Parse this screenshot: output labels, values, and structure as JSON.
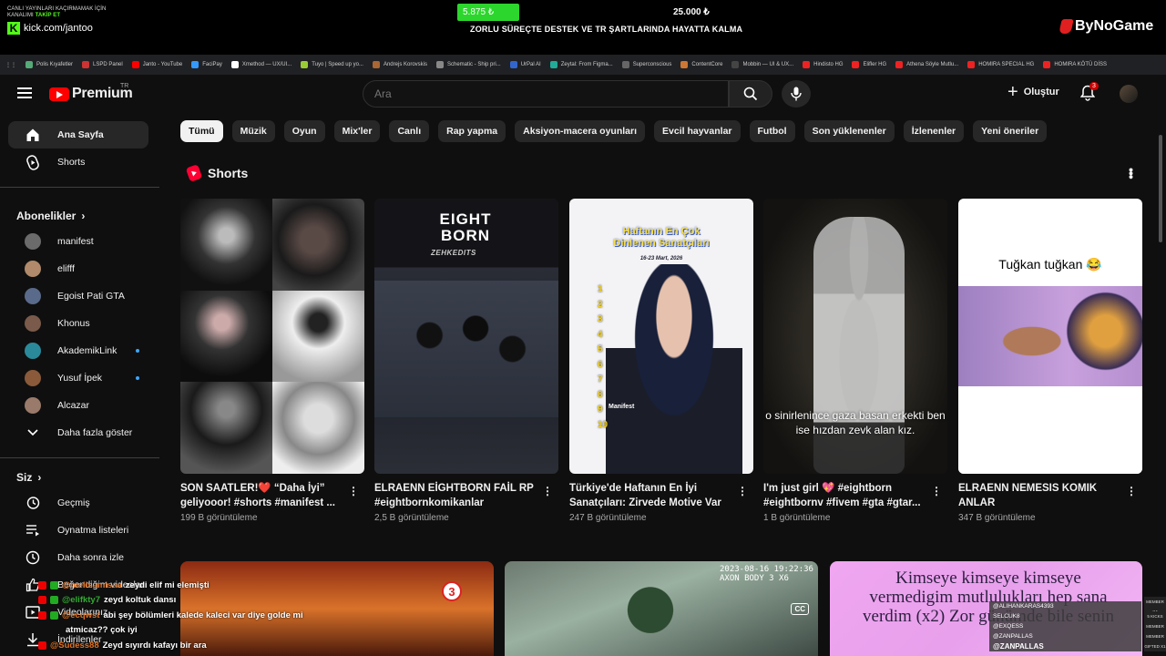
{
  "overlay": {
    "promo_line1": "CANLI YAYINLARI KAÇIRMAMAK İÇİN",
    "promo_line2_a": "KANALIMI ",
    "promo_line2_b": "TAKİP ET",
    "kick_url": "kick.com/jantoo",
    "goal_current": "5.875 ₺",
    "goal_target": "25.000 ₺",
    "goal_caption": "ZORLU SÜREÇTE DESTEK VE TR ŞARTLARINDA HAYATTA KALMA",
    "goal_progress": 0.235,
    "brand": "ByNoGame"
  },
  "bookmarks": [
    "Polis Kıyafetler",
    "LSPD Panel",
    "Janto - YouTube",
    "FaciPay",
    "Xmethod — UX/UI...",
    "Tuyo | Speed up yo...",
    "Andrejs Korovskis",
    "Schematic - Ship pri...",
    "UrPal AI",
    "Zeytal: From Figma...",
    "Superconscious",
    "ContentCore",
    "Mobbin — UI & UX...",
    "Hindisto HG",
    "Elifler HG",
    "Athena Söyle Mutlu...",
    "HOMIRA SPECIAL HG",
    "HOMIRA KÖTÜ DİSS"
  ],
  "masthead": {
    "logo_text": "Premium",
    "country": "TR",
    "search_placeholder": "Ara",
    "create_label": "Oluştur",
    "notifications_count": "3"
  },
  "sidebar": {
    "home": "Ana Sayfa",
    "shorts": "Shorts",
    "subscriptions_title": "Abonelikler",
    "subscriptions": [
      {
        "name": "manifest",
        "color": "#6b6b6b",
        "live": false
      },
      {
        "name": "elifff",
        "color": "#b08a6a",
        "live": false
      },
      {
        "name": "Egoist Pati GTA",
        "color": "#5a6a8a",
        "live": false
      },
      {
        "name": "Khonus",
        "color": "#7a5a4a",
        "live": false
      },
      {
        "name": "AkademikLink",
        "color": "#2a8a9a",
        "live": true
      },
      {
        "name": "Yusuf İpek",
        "color": "#8a5a3a",
        "live": true
      },
      {
        "name": "Alcazar",
        "color": "#9a7a6a",
        "live": false
      }
    ],
    "show_more": "Daha fazla göster",
    "you_title": "Siz",
    "you_items": [
      "Geçmiş",
      "Oynatma listeleri",
      "Daha sonra izle",
      "Beğendiğim videolar",
      "Videolarınız",
      "İndirilenler"
    ]
  },
  "chips": [
    "Tümü",
    "Müzik",
    "Oyun",
    "Mix'ler",
    "Canlı",
    "Rap yapma",
    "Aksiyon-macera oyunları",
    "Evcil hayvanlar",
    "Futbol",
    "Son yüklenenler",
    "İzlenenler",
    "Yeni öneriler"
  ],
  "shorts": {
    "title": "Shorts",
    "items": [
      {
        "title": "SON SAATLER!❤️ “Daha İyi” geliyooor! #shorts #manifest ...",
        "views": "199 B görüntüleme"
      },
      {
        "title": "ELRAENN EİGHTBORN FAİL RP #eightbornkomikanlar",
        "views": "2,5 B görüntüleme"
      },
      {
        "title": "Türkiye'de Haftanın En İyi Sanatçıları: Zirvede Motive Var",
        "views": "247 B görüntüleme"
      },
      {
        "title": "I'm just girl 💖 #eightborn #eightbornv #fivem #gta #gtar...",
        "views": "1 B görüntüleme"
      },
      {
        "title": "ELRAENN NEMESIS KOMIK ANLAR",
        "views": "347 B görüntüleme"
      }
    ],
    "t2_logo": "EIGHT BORN",
    "t2_tag": "ZEHKEDITS",
    "t3_title_a": "Haftanın En Çok",
    "t3_title_b": "Dinlenen Sanatçıları",
    "t3_date": "16-23 Mart, 2026",
    "t3_numbers": "1 2 3 4 5 6 7 8 9 10",
    "t3_manifest": "Manifest",
    "t4_caption": "o sinirlenince gaza basan erkekti ben ise hızdan zevk alan kız.",
    "t5_caption": "Tuğkan tuğkan 😂"
  },
  "videos": {
    "v1_badge": "3",
    "v2_stamp": "2023-08-16 19:22:36 AXON BODY 3 X6",
    "v2_cc": "CC",
    "v3_text": "Kimseye kimseye kimseye vermedigim mutlulukları hep sana verdim (x2) Zor günümde bile senin"
  },
  "chat": [
    {
      "user": "@melisamisaa",
      "msg": "zeydi elif mi elemişti"
    },
    {
      "user": "@elifkty7",
      "msg": "zeyd koltuk dansı"
    },
    {
      "user": "@ecqwst",
      "msg": "abi şey bölümleri kalede kaleci var diye golde mi"
    },
    {
      "user": "",
      "msg": "atmicaz?? çok iyi"
    },
    {
      "user": "@Sudess88",
      "msg": "Zeyd sıyırdı kafayı bir ara"
    }
  ],
  "donors": [
    {
      "name": "@ALIHANKARAS4393",
      "tag": "MEMBER X4"
    },
    {
      "name": "SELCUK8",
      "tag": "5 KICKS"
    },
    {
      "name": "@EXQESS",
      "tag": "MEMBER"
    },
    {
      "name": "@ZANPALLAS",
      "tag": "MEMBER"
    }
  ],
  "donor_big": "@ZANPALLAS",
  "donor_big_tag": "GIFTED X1"
}
